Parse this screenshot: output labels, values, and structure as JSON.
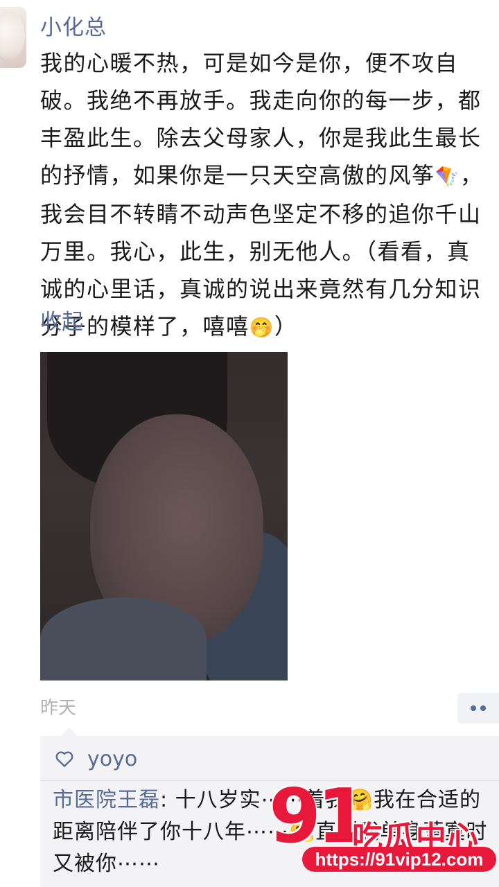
{
  "post": {
    "author": "小化总",
    "text_main": "我的心暖不热，可是如今是你，便不攻自破。我绝不再放手。我走向你的每一步，都丰盈此生。除去父母家人，你是我此生最长的抒情，如果你是一只天空高傲的风筝",
    "kite_emoji": "🪁",
    "text_after_kite": "，我会目不转睛不动声色坚定不移的追你千山万里。我心，此生，别无他人。（看看，真诚的心里话，真诚的说出来竟然有几分知识分子的模样了，嘻嘻",
    "giggle_emoji": "🤭",
    "text_end": "）",
    "collapse_label": "收起",
    "timestamp": "昨天"
  },
  "likes": {
    "names": "yoyo"
  },
  "comment": {
    "author": "市医院王磊",
    "separator": ": ",
    "text": "十八岁实⋯⋯着我🤗我在合适的距离陪伴了你十八年⋯⋯🤗直到我单身落寞时又被你⋯⋯"
  },
  "watermark": {
    "number": "91",
    "brand": "吃瓜中心",
    "url": "https://91vip12.com"
  },
  "colors": {
    "link_blue": "#576b95",
    "watermark_red": "#e8183a",
    "comment_bg": "#f3f3f5"
  },
  "icons": {
    "like": "heart-outline-icon",
    "more": "more-dots-icon"
  }
}
